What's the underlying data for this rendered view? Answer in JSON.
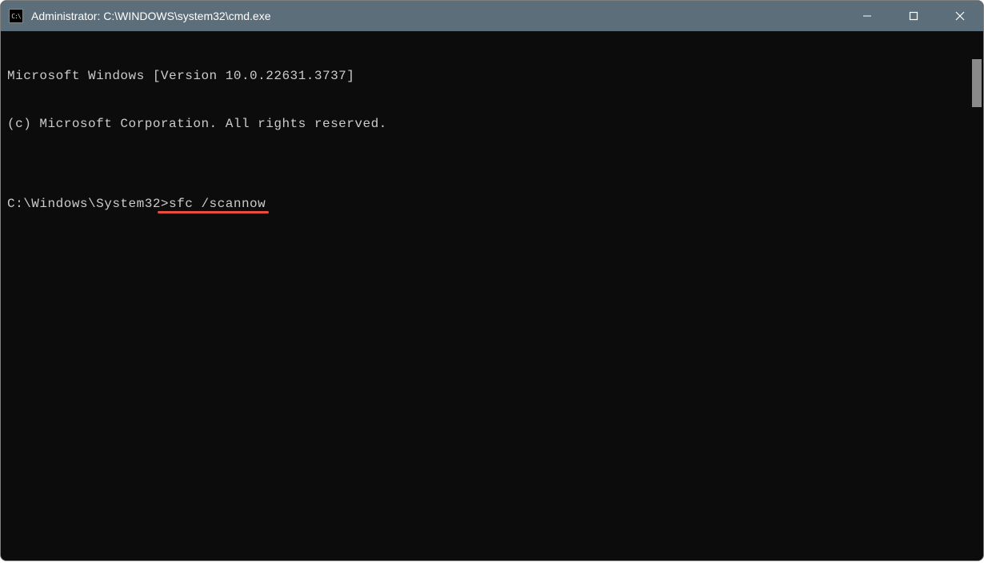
{
  "window": {
    "title": "Administrator: C:\\WINDOWS\\system32\\cmd.exe",
    "icon_label": "C:\\"
  },
  "terminal": {
    "lines": [
      "Microsoft Windows [Version 10.0.22631.3737]",
      "(c) Microsoft Corporation. All rights reserved.",
      "",
      ""
    ],
    "prompt": "C:\\Windows\\System32>",
    "command": "sfc /scannow"
  },
  "annotation": {
    "underline_color": "#e74c3c"
  }
}
